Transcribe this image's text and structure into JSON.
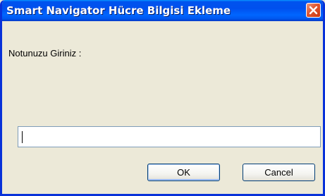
{
  "window": {
    "title": "Smart Navigator Hücre Bilgisi Ekleme",
    "close_icon": "close-icon"
  },
  "dialog": {
    "prompt": "Notunuzu Giriniz :",
    "input_value": ""
  },
  "buttons": {
    "ok_label": "OK",
    "cancel_label": "Cancel"
  },
  "colors": {
    "titlebar": "#0053ee",
    "window_bg": "#ece9d8",
    "close_button": "#e0552f",
    "input_border": "#7f9db9",
    "button_border": "#003c74"
  }
}
